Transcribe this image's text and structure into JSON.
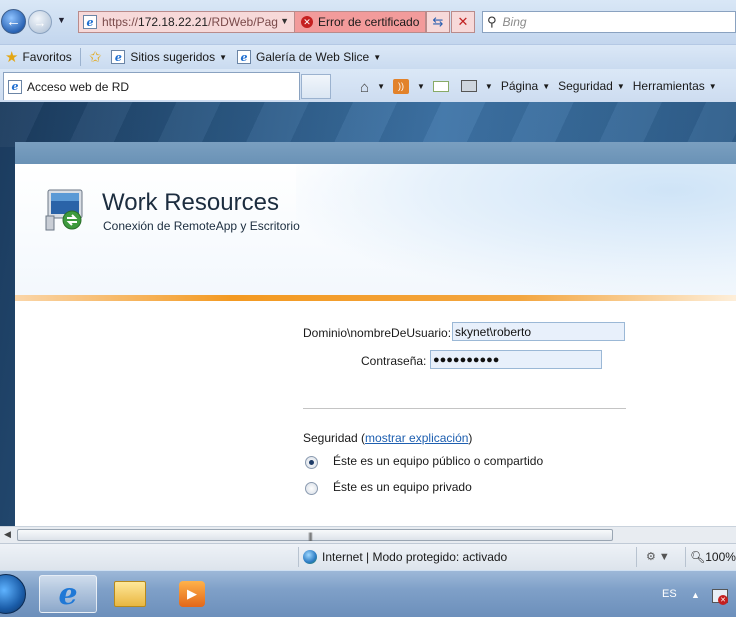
{
  "browser": {
    "url_prefix": "https://",
    "url_host": "172.18.22.21",
    "url_path": "/RDWeb/Pag",
    "cert_error": "Error de certificado",
    "search_placeholder": "Bing"
  },
  "favorites": {
    "favorites_label": "Favoritos",
    "suggested_sites": "Sitios sugeridos",
    "web_slice_gallery": "Galería de Web Slice"
  },
  "tab": {
    "title": "Acceso web de RD"
  },
  "command_bar": {
    "page": "Página",
    "safety": "Seguridad",
    "tools": "Herramientas"
  },
  "header": {
    "title": "Work Resources",
    "subtitle": "Conexión de RemoteApp y Escritorio"
  },
  "login": {
    "domain_user_label": "Dominio\\nombreDeUsuario:",
    "domain_user_value": "skynet\\roberto",
    "password_label": "Contraseña:",
    "password_value": "●●●●●●●●●●",
    "security_label": "Seguridad (",
    "security_link": "mostrar explicación",
    "security_close": ")",
    "options": [
      {
        "label": "Éste es un equipo público o compartido",
        "selected": true
      },
      {
        "label": "Éste es un equipo privado",
        "selected": false
      }
    ]
  },
  "status": {
    "zone": "Internet | Modo protegido: activado",
    "zoom": "100%"
  },
  "taskbar": {
    "language": "ES"
  },
  "colors": {
    "accent_orange": "#f39a22",
    "link_blue": "#1e5fb0",
    "cert_error_red": "#f29b9b"
  }
}
